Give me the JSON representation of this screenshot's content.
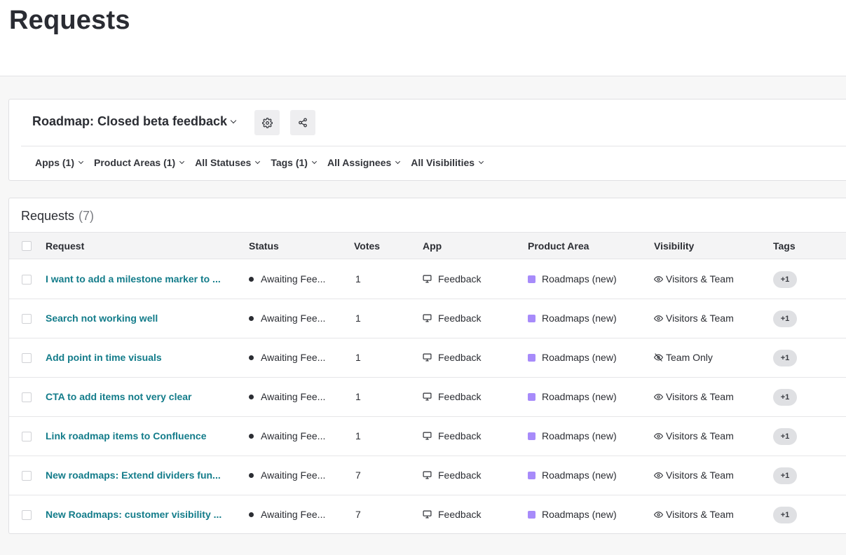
{
  "page": {
    "title": "Requests"
  },
  "roadmap": {
    "title": "Roadmap: Closed beta feedback"
  },
  "filters": [
    {
      "label": "Apps (1)"
    },
    {
      "label": "Product Areas (1)"
    },
    {
      "label": "All Statuses"
    },
    {
      "label": "Tags (1)"
    },
    {
      "label": "All Assignees"
    },
    {
      "label": "All Visibilities"
    }
  ],
  "table": {
    "title": "Requests",
    "count": "(7)",
    "columns": {
      "request": "Request",
      "status": "Status",
      "votes": "Votes",
      "app": "App",
      "product_area": "Product Area",
      "visibility": "Visibility",
      "tags": "Tags"
    },
    "rows": [
      {
        "request": "I want to add a milestone marker to ...",
        "status": "Awaiting Fee...",
        "votes": "1",
        "app": "Feedback",
        "product_area": "Roadmaps (new)",
        "visibility": "Visitors & Team",
        "visibility_icon": "eye-icon",
        "tags": "+1"
      },
      {
        "request": "Search not working well",
        "status": "Awaiting Fee...",
        "votes": "1",
        "app": "Feedback",
        "product_area": "Roadmaps (new)",
        "visibility": "Visitors & Team",
        "visibility_icon": "eye-icon",
        "tags": "+1"
      },
      {
        "request": "Add point in time visuals",
        "status": "Awaiting Fee...",
        "votes": "1",
        "app": "Feedback",
        "product_area": "Roadmaps (new)",
        "visibility": "Team Only",
        "visibility_icon": "eye-off-icon",
        "tags": "+1"
      },
      {
        "request": "CTA to add items not very clear",
        "status": "Awaiting Fee...",
        "votes": "1",
        "app": "Feedback",
        "product_area": "Roadmaps (new)",
        "visibility": "Visitors & Team",
        "visibility_icon": "eye-icon",
        "tags": "+1"
      },
      {
        "request": "Link roadmap items to Confluence",
        "status": "Awaiting Fee...",
        "votes": "1",
        "app": "Feedback",
        "product_area": "Roadmaps (new)",
        "visibility": "Visitors & Team",
        "visibility_icon": "eye-icon",
        "tags": "+1"
      },
      {
        "request": "New roadmaps: Extend dividers fun...",
        "status": "Awaiting Fee...",
        "votes": "7",
        "app": "Feedback",
        "product_area": "Roadmaps (new)",
        "visibility": "Visitors & Team",
        "visibility_icon": "eye-icon",
        "tags": "+1"
      },
      {
        "request": "New Roadmaps: customer visibility ...",
        "status": "Awaiting Fee...",
        "votes": "7",
        "app": "Feedback",
        "product_area": "Roadmaps (new)",
        "visibility": "Visitors & Team",
        "visibility_icon": "eye-icon",
        "tags": "+1"
      }
    ]
  },
  "colors": {
    "link": "#137c8a",
    "status_dot": "#2b2d33",
    "product_area_swatch": "#a78bfa",
    "tag_pill": "#dfe0e3"
  }
}
